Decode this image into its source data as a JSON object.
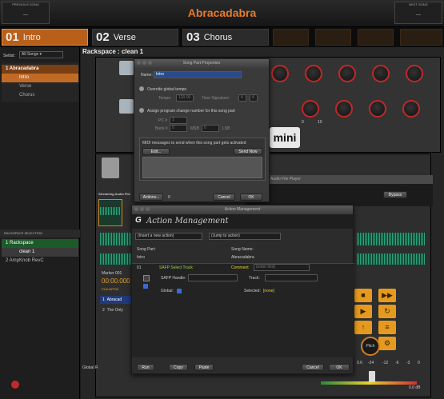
{
  "header": {
    "prev_label": "PREVIOUS SONG",
    "prev_value": "---",
    "next_label": "NEXT SONG",
    "next_value": "---",
    "title": "Abracadabra"
  },
  "parts": [
    {
      "num": "01",
      "name": "Intro"
    },
    {
      "num": "02",
      "name": "Verse"
    },
    {
      "num": "03",
      "name": "Chorus"
    }
  ],
  "sidebar": {
    "setlist_label": "Setlist:",
    "setlist_value": "All Songs",
    "songs": [
      {
        "label": "1  Abracadabra"
      },
      {
        "label": "Intro"
      },
      {
        "label": "Verse"
      },
      {
        "label": "Chorus"
      }
    ],
    "rackspace_header": "RACKSPACE SELECTION",
    "rackspaces": [
      {
        "label": "1  Rackspace"
      },
      {
        "label": "clean 1"
      },
      {
        "label": "2  AmpKnob RevC"
      }
    ]
  },
  "rackspace": {
    "title": "Rackspace : clean 1",
    "mini": "mini",
    "streaming": "Streaming Audio File",
    "player_title": "Audio File Player",
    "bypass": "Bypass",
    "marker": "Marker 001",
    "time": "00:00.000",
    "track_header": "FILE/ARTW",
    "tracks": [
      {
        "num": "1",
        "name": "Abracad"
      },
      {
        "num": "2",
        "name": "The Only"
      }
    ],
    "pitch": "Pitch",
    "global_r": "Global R",
    "knob_ticks": [
      "0",
      "10"
    ],
    "meter_scale": [
      "0.6",
      "-24",
      "-12",
      "-6",
      "-3",
      "0"
    ],
    "meter_db": "0.0 dB"
  },
  "song_part": {
    "title": "Song Part Properties",
    "name_label": "Name:",
    "name_value": "Intro",
    "override": "Override global tempo",
    "tempo_label": "Tempo:",
    "tempo_value": "120.00",
    "ts_label": "Time Signature:",
    "ts_num": "4",
    "ts_den": "4",
    "assign": "Assign program change number for this song part",
    "pc_label": "PC #",
    "pc_value": "1",
    "bank_label": "Bank #",
    "bank_value": "0",
    "msb": "MSB",
    "lsb_value": "0",
    "lsb": "LSB",
    "midi_title": "MIDI messages to send when this song part gets activated",
    "edit": "Edit...",
    "send_now": "Send Now",
    "actions": "Actions...",
    "actions_count": "0",
    "cancel": "Cancel",
    "ok": "OK"
  },
  "action_mgmt": {
    "window_title": "Action Management",
    "banner": "Action Management",
    "insert": "(Insert a new action)",
    "jump": "(Jump to action)",
    "song_part_label": "Song Part:",
    "song_part_value": "Intro",
    "song_name_label": "Song Name:",
    "song_name_value": "Abracadabra",
    "row_num": "01",
    "row_name": "SAFP Select Track",
    "comment_label": "Comment",
    "comment_placeholder": "(enter hint)",
    "handle_label": "SAFP Handle:",
    "track_label": "Track:",
    "global_label": "Global:",
    "selected_label": "Selected:",
    "selected_value": "[none]",
    "run": "Run",
    "copy": "Copy",
    "paste": "Paste",
    "cancel": "Cancel",
    "ok": "OK"
  }
}
